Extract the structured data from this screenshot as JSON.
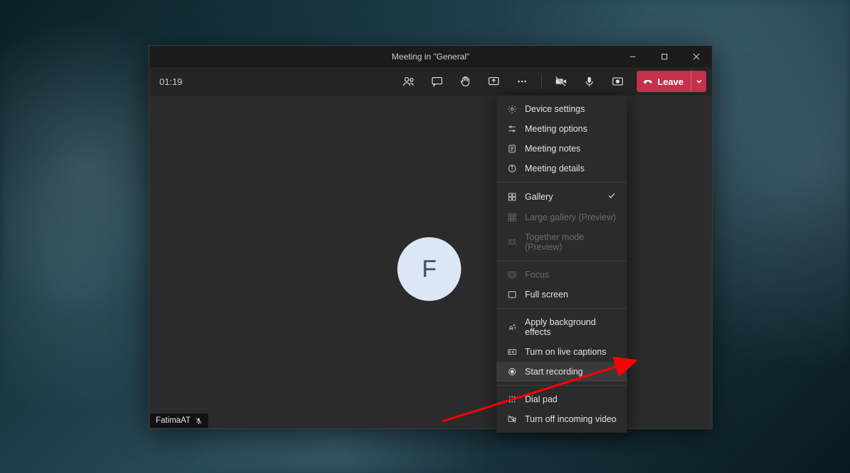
{
  "titlebar": {
    "title": "Meeting in \"General\""
  },
  "toolbar": {
    "timer": "01:19",
    "leave_label": "Leave"
  },
  "participant": {
    "initial": "F",
    "name": "FatimaAT"
  },
  "menu": {
    "items": [
      {
        "label": "Device settings",
        "icon": "gear",
        "disabled": false
      },
      {
        "label": "Meeting options",
        "icon": "sliders",
        "disabled": false
      },
      {
        "label": "Meeting notes",
        "icon": "notes",
        "disabled": false
      },
      {
        "label": "Meeting details",
        "icon": "info",
        "disabled": false
      }
    ],
    "view_items": [
      {
        "label": "Gallery",
        "icon": "grid",
        "disabled": false,
        "checked": true
      },
      {
        "label": "Large gallery (Preview)",
        "icon": "large-grid",
        "disabled": true,
        "checked": false
      },
      {
        "label": "Together mode (Preview)",
        "icon": "people",
        "disabled": true,
        "checked": false
      }
    ],
    "focus_items": [
      {
        "label": "Focus",
        "icon": "focus",
        "disabled": true
      },
      {
        "label": "Full screen",
        "icon": "fullscreen",
        "disabled": false
      }
    ],
    "action_items": [
      {
        "label": "Apply background effects",
        "icon": "sparkle",
        "disabled": false,
        "highlighted": false
      },
      {
        "label": "Turn on live captions",
        "icon": "cc",
        "disabled": false,
        "highlighted": false
      },
      {
        "label": "Start recording",
        "icon": "record",
        "disabled": false,
        "highlighted": true
      }
    ],
    "extra_items": [
      {
        "label": "Dial pad",
        "icon": "dialpad",
        "disabled": false
      },
      {
        "label": "Turn off incoming video",
        "icon": "video-off",
        "disabled": false
      }
    ]
  },
  "colors": {
    "leave_red": "#c4314b",
    "avatar_bg": "#dbe7f4"
  }
}
